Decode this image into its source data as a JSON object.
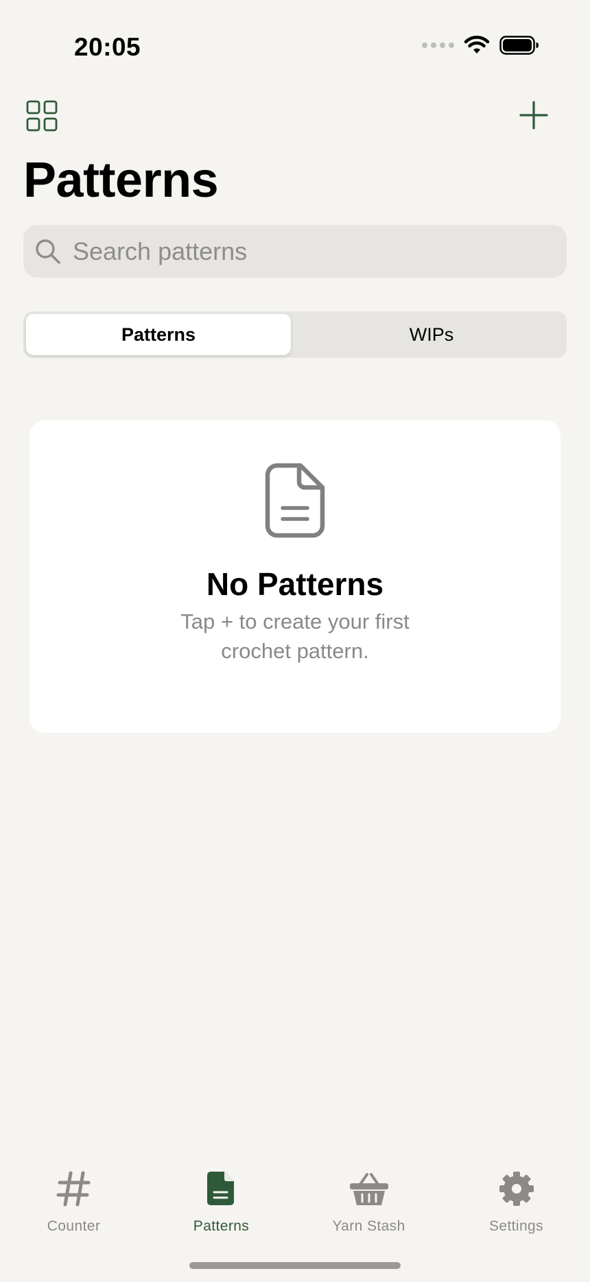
{
  "status_bar": {
    "time": "20:05",
    "icons": [
      "signal-dots-icon",
      "wifi-icon",
      "battery-icon"
    ]
  },
  "nav": {
    "left_icon": "grid-icon",
    "right_icon": "plus-icon",
    "title": "Patterns"
  },
  "search": {
    "placeholder": "Search patterns",
    "value": ""
  },
  "segmented_control": {
    "segments": [
      {
        "label": "Patterns",
        "selected": true
      },
      {
        "label": "WIPs",
        "selected": false
      }
    ]
  },
  "empty_state": {
    "icon": "document-icon",
    "title": "No Patterns",
    "subtitle": "Tap + to create your first crochet pattern."
  },
  "tab_bar": {
    "items": [
      {
        "label": "Counter",
        "icon": "hashtag-icon",
        "active": false
      },
      {
        "label": "Patterns",
        "icon": "document-icon",
        "active": true
      },
      {
        "label": "Yarn Stash",
        "icon": "basket-icon",
        "active": false
      },
      {
        "label": "Settings",
        "icon": "gear-icon",
        "active": false
      }
    ]
  },
  "colors": {
    "background": "#f5f4f1",
    "accent": "#2f5a3a",
    "inactive": "#8b8a87",
    "card": "#ffffff",
    "field": "#e6e5e1"
  }
}
